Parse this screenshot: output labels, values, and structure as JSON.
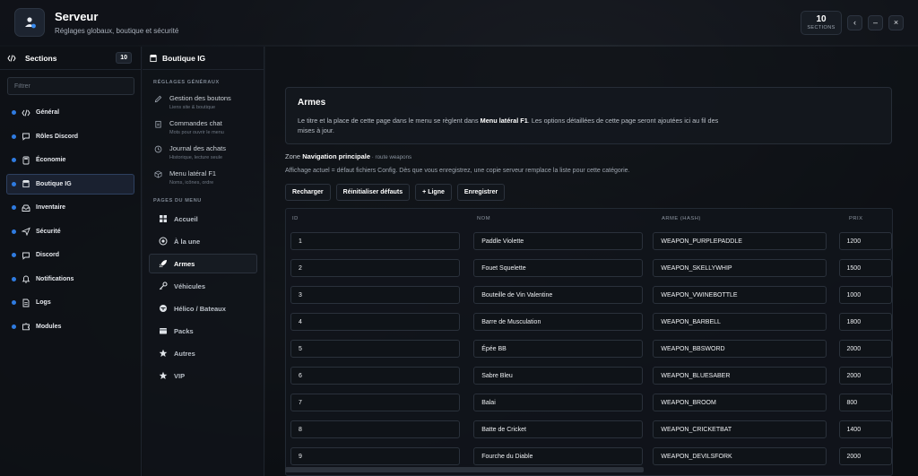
{
  "header": {
    "title": "Serveur",
    "subtitle": "Réglages globaux, boutique et sécurité",
    "counter_value": "10",
    "counter_label": "SECTIONS"
  },
  "sidebar": {
    "title": "Sections",
    "count": "10",
    "filter_placeholder": "Filtrer",
    "items": [
      {
        "label": "Général",
        "icon": "code-icon"
      },
      {
        "label": "Rôles Discord",
        "icon": "chat-icon"
      },
      {
        "label": "Économie",
        "icon": "calculator-icon"
      },
      {
        "label": "Boutique IG",
        "icon": "store-icon"
      },
      {
        "label": "Inventaire",
        "icon": "box-icon"
      },
      {
        "label": "Sécurité",
        "icon": "send-icon"
      },
      {
        "label": "Discord",
        "icon": "chat-icon"
      },
      {
        "label": "Notifications",
        "icon": "bell-icon"
      },
      {
        "label": "Logs",
        "icon": "document-icon"
      },
      {
        "label": "Modules",
        "icon": "puzzle-icon"
      }
    ]
  },
  "panel2": {
    "title": "Boutique IG",
    "general_label": "RÉGLAGES GÉNÉRAUX",
    "general_items": [
      {
        "title": "Gestion des boutons",
        "subtitle": "Liens site & boutique"
      },
      {
        "title": "Commandes chat",
        "subtitle": "Mots pour ouvrir le menu"
      },
      {
        "title": "Journal des achats",
        "subtitle": "Historique, lecture seule"
      },
      {
        "title": "Menu latéral F1",
        "subtitle": "Noms, icônes, ordre"
      }
    ],
    "pages_label": "PAGES DU MENU",
    "pages": [
      {
        "label": "Accueil"
      },
      {
        "label": "À la une"
      },
      {
        "label": "Armes"
      },
      {
        "label": "Véhicules"
      },
      {
        "label": "Hélico / Bateaux"
      },
      {
        "label": "Packs"
      },
      {
        "label": "Autres"
      },
      {
        "label": "VIP"
      }
    ]
  },
  "main": {
    "title": "Armes",
    "info_pre": "Le titre et la place de cette page dans le menu se règlent dans ",
    "info_bold": "Menu latéral F1",
    "info_post": ". Les options détaillées de cette page seront ajoutées ici au fil des mises à jour.",
    "zone_pre": "Zone ",
    "zone_bold": "Navigation principale",
    "zone_route": " · route weapons",
    "note": "Affichage actuel = défaut fichiers Config. Dès que vous enregistrez, une copie serveur remplace la liste pour cette catégorie.",
    "buttons": {
      "reload": "Recharger",
      "reset": "Réinitialiser défauts",
      "add_row": "+ Ligne",
      "save": "Enregistrer"
    },
    "columns": {
      "id": "ID",
      "nom": "NOM",
      "hash": "ARME (HASH)",
      "prix": "PRIX"
    },
    "rows": [
      {
        "id": "1",
        "nom": "Paddle Violette",
        "hash": "WEAPON_PURPLEPADDLE",
        "prix": "1200"
      },
      {
        "id": "2",
        "nom": "Fouet Squelette",
        "hash": "WEAPON_SKELLYWHIP",
        "prix": "1500"
      },
      {
        "id": "3",
        "nom": "Bouteille de Vin Valentine",
        "hash": "WEAPON_VWINEBOTTLE",
        "prix": "1000"
      },
      {
        "id": "4",
        "nom": "Barre de Musculation",
        "hash": "WEAPON_BARBELL",
        "prix": "1800"
      },
      {
        "id": "5",
        "nom": "Épée BB",
        "hash": "WEAPON_BBSWORD",
        "prix": "2000"
      },
      {
        "id": "6",
        "nom": "Sabre Bleu",
        "hash": "WEAPON_BLUESABER",
        "prix": "2000"
      },
      {
        "id": "7",
        "nom": "Balai",
        "hash": "WEAPON_BROOM",
        "prix": "800"
      },
      {
        "id": "8",
        "nom": "Batte de Cricket",
        "hash": "WEAPON_CRICKETBAT",
        "prix": "1400"
      },
      {
        "id": "9",
        "nom": "Fourche du Diable",
        "hash": "WEAPON_DEVILSFORK",
        "prix": "2000"
      }
    ]
  },
  "colors": {
    "accent": "#2f7be0",
    "background": "#0b0e13",
    "panel": "#11151b"
  }
}
